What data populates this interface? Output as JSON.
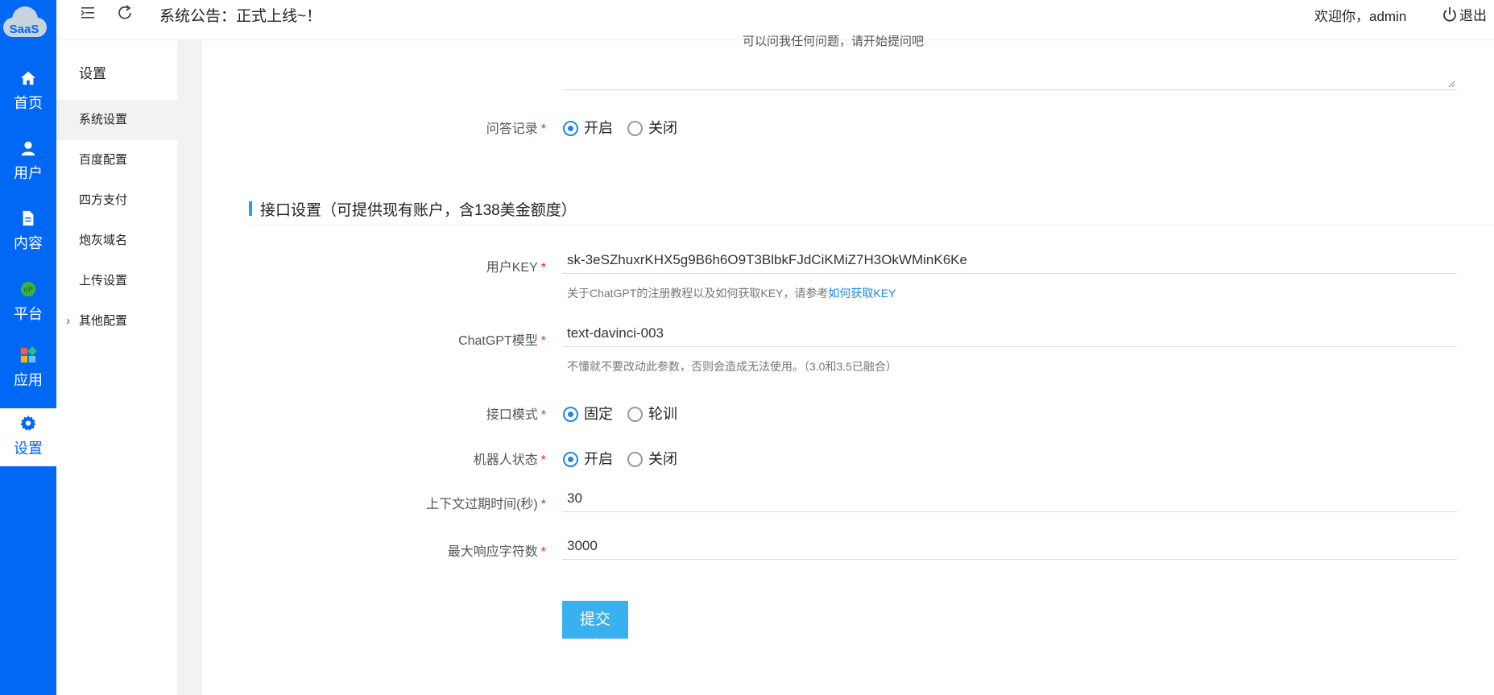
{
  "rail": {
    "logo_text": "SaaS",
    "items": [
      {
        "label": "首页",
        "icon": "home-icon"
      },
      {
        "label": "用户",
        "icon": "user-icon"
      },
      {
        "label": "内容",
        "icon": "document-icon"
      },
      {
        "label": "平台",
        "icon": "platform-icon"
      },
      {
        "label": "应用",
        "icon": "apps-icon"
      },
      {
        "label": "设置",
        "icon": "gear-icon"
      }
    ],
    "active_index": 5
  },
  "subnav": {
    "title": "设置",
    "items": [
      {
        "label": "系统设置"
      },
      {
        "label": "百度配置"
      },
      {
        "label": "四方支付"
      },
      {
        "label": "炮灰域名"
      },
      {
        "label": "上传设置"
      },
      {
        "label": "其他配置"
      }
    ],
    "active_index": 0
  },
  "topbar": {
    "notice": "系统公告：正式上线~！",
    "welcome": "欢迎你，admin",
    "logout": "退出"
  },
  "form": {
    "textarea_overflow_text": "可以问我任何问题，请开始提问吧",
    "qa_record": {
      "label": "问答记录",
      "options": [
        "开启",
        "关闭"
      ],
      "selected": "开启"
    },
    "section_title": "接口设置（可提供现有账户，含138美金额度）",
    "user_key": {
      "label": "用户KEY",
      "value": "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",
      "help_prefix": "关于ChatGPT的注册教程以及如何获取KEY，请参考",
      "help_link": "如何获取KEY"
    },
    "model": {
      "label": "ChatGPT模型",
      "value": "text-davinci-003",
      "help": "不懂就不要改动此参数，否则会造成无法使用。（3.0和3.5已融合）"
    },
    "api_mode": {
      "label": "接口模式",
      "options": [
        "固定",
        "轮训"
      ],
      "selected": "固定"
    },
    "bot_status": {
      "label": "机器人状态",
      "options": [
        "开启",
        "关闭"
      ],
      "selected": "开启"
    },
    "context_expiry": {
      "label": "上下文过期时间(秒)",
      "value": "30"
    },
    "max_chars": {
      "label": "最大响应字符数",
      "value": "3000"
    },
    "submit_label": "提交"
  },
  "colors": {
    "rail": "#0068f4",
    "accent": "#1e88e5",
    "submit": "#3ab0f0",
    "required": "#f5222d"
  }
}
